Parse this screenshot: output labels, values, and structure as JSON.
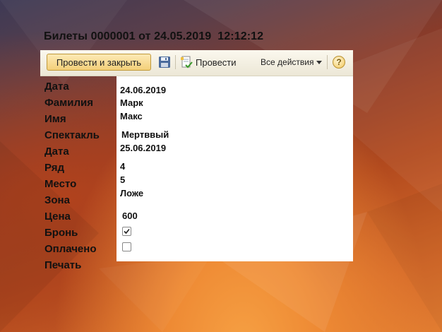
{
  "window": {
    "title": "Билеты 0000001 от 24.05.2019  12:12:12"
  },
  "toolbar": {
    "post_close_label": "Провести и закрыть",
    "save_icon": "floppy-disk-icon",
    "post_label": "Провести",
    "post_icon": "document-post-icon",
    "actions_label": "Все действия",
    "actions_icon": "dropdown-arrow-icon",
    "help_icon": "help-icon",
    "help_glyph": "?"
  },
  "fields": {
    "date": {
      "label": "Дата",
      "value": "24.06.2019"
    },
    "surname": {
      "label": "Фамилия",
      "value": "Марк"
    },
    "name": {
      "label": "Имя",
      "value": "Макс"
    },
    "play": {
      "label": "Спектакль",
      "value": "Мертввый"
    },
    "show_date": {
      "label": "Дата",
      "value": "25.06.2019"
    },
    "row": {
      "label": "Ряд",
      "value": "4"
    },
    "seat": {
      "label": "Место",
      "value": "5"
    },
    "zone": {
      "label": "Зона",
      "value": "Ложе"
    },
    "price": {
      "label": "Цена",
      "value": "600"
    },
    "reserved": {
      "label": "Бронь",
      "checked": true
    },
    "paid": {
      "label": "Оплачено",
      "checked": false
    },
    "print": {
      "label": "Печать"
    }
  },
  "colors": {
    "toolbar_bg": "#f4f0e2",
    "primary_button": "#f3cf78",
    "form_bg": "#ffffff",
    "text": "#111111"
  }
}
